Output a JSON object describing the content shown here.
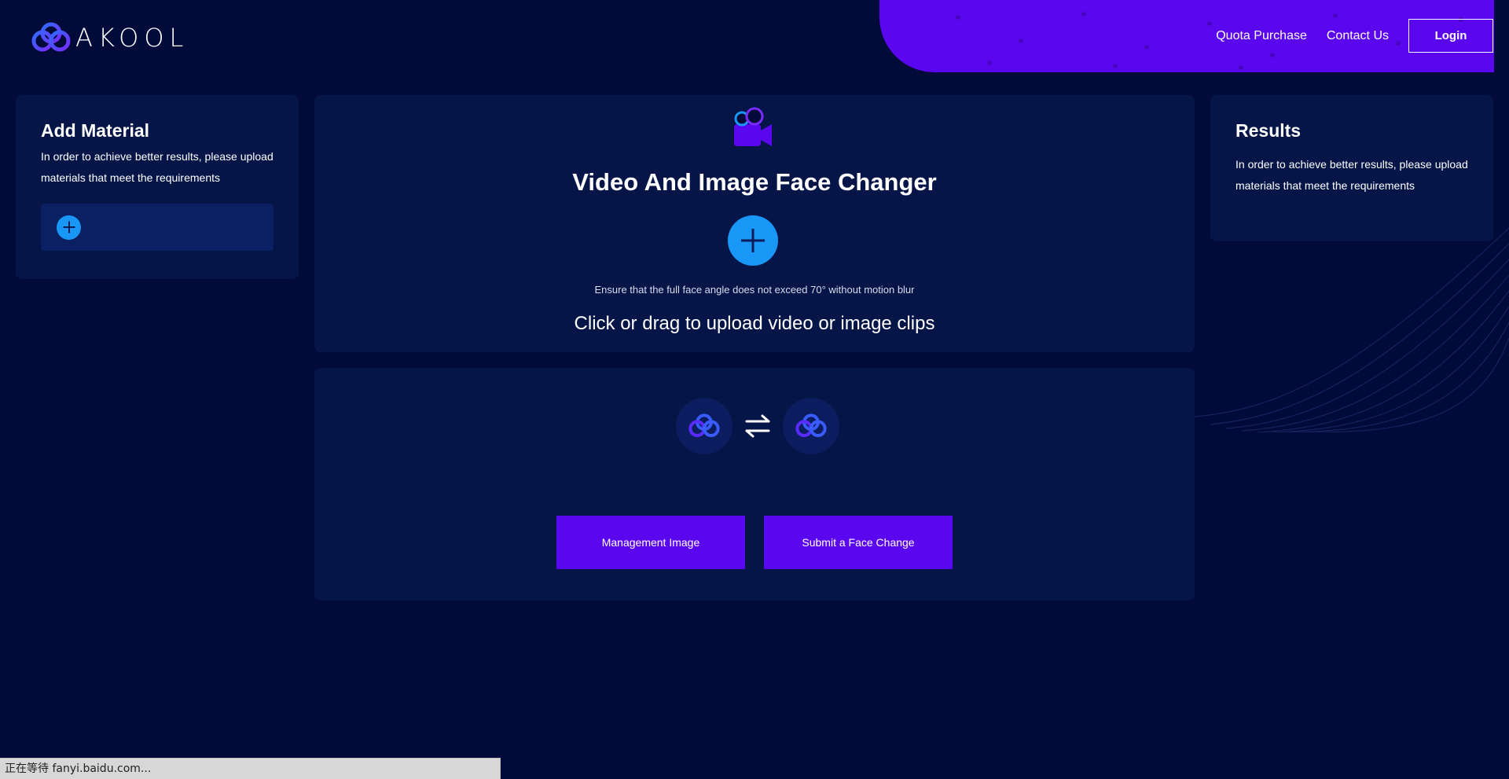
{
  "header": {
    "logo_text": "AKOOL",
    "nav": {
      "quota_purchase": "Quota Purchase",
      "contact_us": "Contact Us",
      "login": "Login"
    }
  },
  "add_material": {
    "title": "Add Material",
    "description": "In order to achieve better results, please upload materials that meet the requirements"
  },
  "main": {
    "title": "Video And Image Face Changer",
    "hint": "Ensure that the full face angle does not exceed 70° without motion blur",
    "upload_text": "Click or drag to upload video or image clips",
    "management_button": "Management Image",
    "submit_button": "Submit a Face Change"
  },
  "results": {
    "title": "Results",
    "description": "In order to achieve better results, please upload materials that meet the requirements"
  },
  "status_bar": {
    "text": "正在等待 fanyi.baidu.com..."
  },
  "colors": {
    "background": "#020a3a",
    "panel": "#061548",
    "accent_purple": "#5a07f0",
    "accent_blue": "#1897f6"
  },
  "icons": [
    "akool-logo-icon",
    "video-camera-icon",
    "plus-icon",
    "swap-icon",
    "avatar-logo-icon"
  ]
}
